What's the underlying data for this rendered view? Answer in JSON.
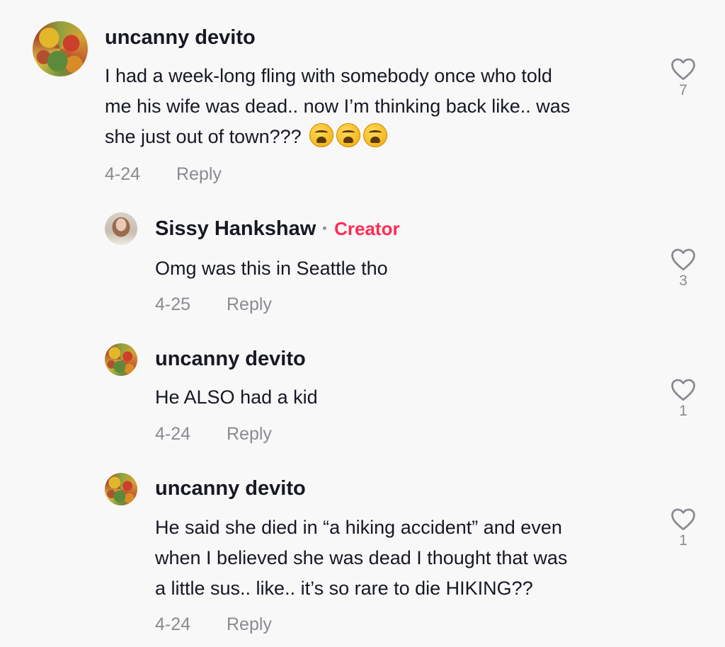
{
  "comments": [
    {
      "username": "uncanny devito",
      "lines": [
        "I had a week-long fling with somebody once who told",
        "me his wife was dead.. now I’m thinking back like.. was",
        "she just out of town???"
      ],
      "emojis": [
        "weary-face",
        "weary-face",
        "weary-face"
      ],
      "date": "4-24",
      "reply_label": "Reply",
      "likes": "7"
    },
    {
      "username": "Sissy Hankshaw",
      "creator_sep": "·",
      "creator_badge": "Creator",
      "lines": [
        "Omg was this in Seattle tho"
      ],
      "date": "4-25",
      "reply_label": "Reply",
      "likes": "3"
    },
    {
      "username": "uncanny devito",
      "lines": [
        "He ALSO had a kid"
      ],
      "date": "4-24",
      "reply_label": "Reply",
      "likes": "1"
    },
    {
      "username": "uncanny devito",
      "lines": [
        "He said she died in “a hiking accident” and even",
        "when I believed she was dead I thought that was",
        "a little sus.. like.. it’s so rare to die HIKING??"
      ],
      "date": "4-24",
      "reply_label": "Reply",
      "likes": "1"
    }
  ],
  "colors": {
    "background": "#f8f8f8",
    "text": "#161823",
    "muted": "#8a8b91",
    "creator": "#fe2c55"
  }
}
